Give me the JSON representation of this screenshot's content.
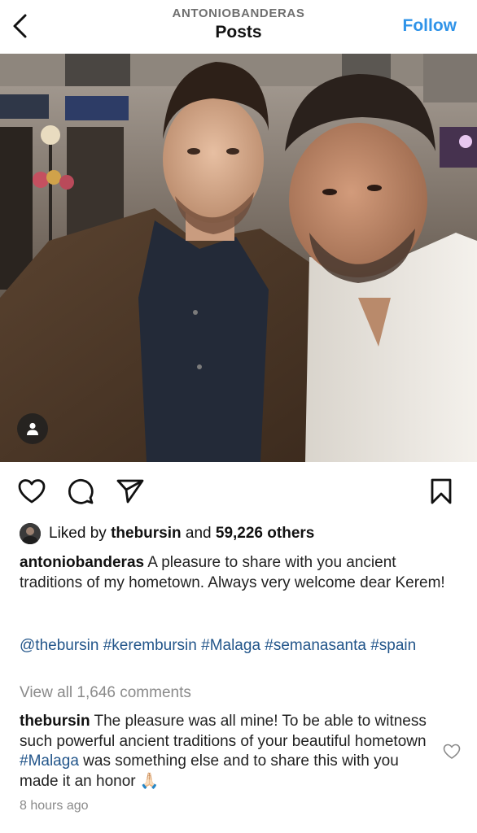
{
  "header": {
    "username": "ANTONIOBANDERAS",
    "title": "Posts",
    "follow_label": "Follow",
    "back_icon": "chevron-left-icon"
  },
  "photo": {
    "tag_icon": "person-icon"
  },
  "actions": {
    "like_icon": "heart-icon",
    "comment_icon": "comment-icon",
    "share_icon": "send-icon",
    "save_icon": "bookmark-icon"
  },
  "likes": {
    "prefix": "Liked by",
    "user": "thebursin",
    "middle": "and",
    "others": "59,226 others"
  },
  "caption": {
    "user": "antoniobanderas",
    "text": " A pleasure to share with you ancient traditions of my hometown. Always very welcome dear Kerem!",
    "tags": [
      "@thebursin",
      "#kerembursin",
      "#Malaga",
      "#semanasanta",
      "#spain"
    ]
  },
  "comments": {
    "view_all": "View all 1,646 comments",
    "top": {
      "user": "thebursin",
      "text_before": " The pleasure was all mine! To be able to witness such powerful ancient traditions of your beautiful  hometown ",
      "hashtag": "#Malaga",
      "text_after": " was something else and to share this with you made it an honor ",
      "emoji": "🙏🏻"
    }
  },
  "post_time": "8 hours ago",
  "colors": {
    "link_blue": "#2f93e8",
    "hashtag_blue": "#22558a",
    "muted": "#8a8a8a"
  }
}
